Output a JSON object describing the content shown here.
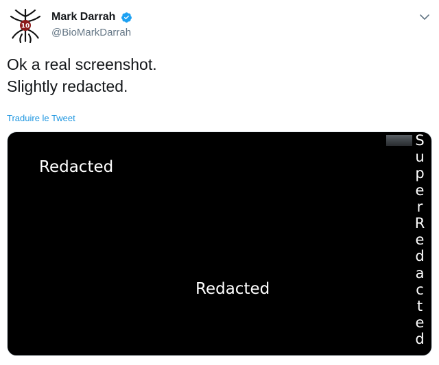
{
  "user": {
    "display_name": "Mark Darrah",
    "handle": "@BioMarkDarrah",
    "verified": true,
    "avatar_icon": "dragon-age-logo-icon"
  },
  "tweet": {
    "lines": [
      "Ok a real screenshot.",
      "Slightly redacted."
    ],
    "translate_label": "Traduire le Tweet"
  },
  "media": {
    "label_1": "Redacted",
    "label_2": "Redacted",
    "vertical_letters": [
      "S",
      "u",
      "p",
      "e",
      "r",
      "R",
      "e",
      "d",
      "a",
      "c",
      "t",
      "e",
      "d"
    ]
  },
  "colors": {
    "link": "#1b95e0",
    "verified": "#1da1f2",
    "text": "#14171a",
    "muted": "#657786",
    "media_bg": "#000000"
  }
}
